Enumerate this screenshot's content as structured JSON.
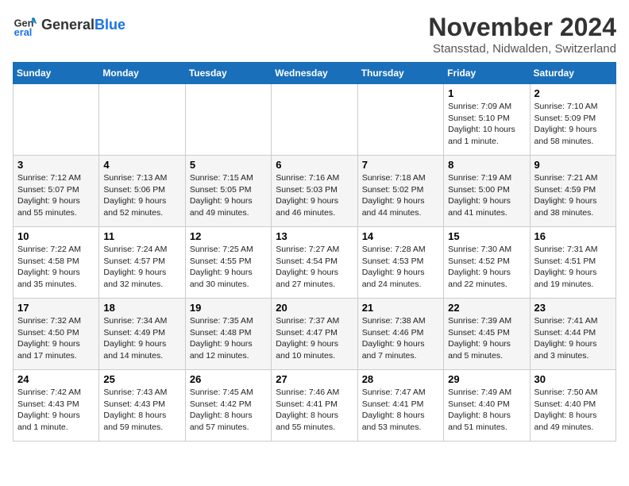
{
  "header": {
    "logo_line1": "General",
    "logo_line2": "Blue",
    "month": "November 2024",
    "location": "Stansstad, Nidwalden, Switzerland"
  },
  "days_of_week": [
    "Sunday",
    "Monday",
    "Tuesday",
    "Wednesday",
    "Thursday",
    "Friday",
    "Saturday"
  ],
  "weeks": [
    [
      {
        "day": "",
        "info": ""
      },
      {
        "day": "",
        "info": ""
      },
      {
        "day": "",
        "info": ""
      },
      {
        "day": "",
        "info": ""
      },
      {
        "day": "",
        "info": ""
      },
      {
        "day": "1",
        "info": "Sunrise: 7:09 AM\nSunset: 5:10 PM\nDaylight: 10 hours and 1 minute."
      },
      {
        "day": "2",
        "info": "Sunrise: 7:10 AM\nSunset: 5:09 PM\nDaylight: 9 hours and 58 minutes."
      }
    ],
    [
      {
        "day": "3",
        "info": "Sunrise: 7:12 AM\nSunset: 5:07 PM\nDaylight: 9 hours and 55 minutes."
      },
      {
        "day": "4",
        "info": "Sunrise: 7:13 AM\nSunset: 5:06 PM\nDaylight: 9 hours and 52 minutes."
      },
      {
        "day": "5",
        "info": "Sunrise: 7:15 AM\nSunset: 5:05 PM\nDaylight: 9 hours and 49 minutes."
      },
      {
        "day": "6",
        "info": "Sunrise: 7:16 AM\nSunset: 5:03 PM\nDaylight: 9 hours and 46 minutes."
      },
      {
        "day": "7",
        "info": "Sunrise: 7:18 AM\nSunset: 5:02 PM\nDaylight: 9 hours and 44 minutes."
      },
      {
        "day": "8",
        "info": "Sunrise: 7:19 AM\nSunset: 5:00 PM\nDaylight: 9 hours and 41 minutes."
      },
      {
        "day": "9",
        "info": "Sunrise: 7:21 AM\nSunset: 4:59 PM\nDaylight: 9 hours and 38 minutes."
      }
    ],
    [
      {
        "day": "10",
        "info": "Sunrise: 7:22 AM\nSunset: 4:58 PM\nDaylight: 9 hours and 35 minutes."
      },
      {
        "day": "11",
        "info": "Sunrise: 7:24 AM\nSunset: 4:57 PM\nDaylight: 9 hours and 32 minutes."
      },
      {
        "day": "12",
        "info": "Sunrise: 7:25 AM\nSunset: 4:55 PM\nDaylight: 9 hours and 30 minutes."
      },
      {
        "day": "13",
        "info": "Sunrise: 7:27 AM\nSunset: 4:54 PM\nDaylight: 9 hours and 27 minutes."
      },
      {
        "day": "14",
        "info": "Sunrise: 7:28 AM\nSunset: 4:53 PM\nDaylight: 9 hours and 24 minutes."
      },
      {
        "day": "15",
        "info": "Sunrise: 7:30 AM\nSunset: 4:52 PM\nDaylight: 9 hours and 22 minutes."
      },
      {
        "day": "16",
        "info": "Sunrise: 7:31 AM\nSunset: 4:51 PM\nDaylight: 9 hours and 19 minutes."
      }
    ],
    [
      {
        "day": "17",
        "info": "Sunrise: 7:32 AM\nSunset: 4:50 PM\nDaylight: 9 hours and 17 minutes."
      },
      {
        "day": "18",
        "info": "Sunrise: 7:34 AM\nSunset: 4:49 PM\nDaylight: 9 hours and 14 minutes."
      },
      {
        "day": "19",
        "info": "Sunrise: 7:35 AM\nSunset: 4:48 PM\nDaylight: 9 hours and 12 minutes."
      },
      {
        "day": "20",
        "info": "Sunrise: 7:37 AM\nSunset: 4:47 PM\nDaylight: 9 hours and 10 minutes."
      },
      {
        "day": "21",
        "info": "Sunrise: 7:38 AM\nSunset: 4:46 PM\nDaylight: 9 hours and 7 minutes."
      },
      {
        "day": "22",
        "info": "Sunrise: 7:39 AM\nSunset: 4:45 PM\nDaylight: 9 hours and 5 minutes."
      },
      {
        "day": "23",
        "info": "Sunrise: 7:41 AM\nSunset: 4:44 PM\nDaylight: 9 hours and 3 minutes."
      }
    ],
    [
      {
        "day": "24",
        "info": "Sunrise: 7:42 AM\nSunset: 4:43 PM\nDaylight: 9 hours and 1 minute."
      },
      {
        "day": "25",
        "info": "Sunrise: 7:43 AM\nSunset: 4:43 PM\nDaylight: 8 hours and 59 minutes."
      },
      {
        "day": "26",
        "info": "Sunrise: 7:45 AM\nSunset: 4:42 PM\nDaylight: 8 hours and 57 minutes."
      },
      {
        "day": "27",
        "info": "Sunrise: 7:46 AM\nSunset: 4:41 PM\nDaylight: 8 hours and 55 minutes."
      },
      {
        "day": "28",
        "info": "Sunrise: 7:47 AM\nSunset: 4:41 PM\nDaylight: 8 hours and 53 minutes."
      },
      {
        "day": "29",
        "info": "Sunrise: 7:49 AM\nSunset: 4:40 PM\nDaylight: 8 hours and 51 minutes."
      },
      {
        "day": "30",
        "info": "Sunrise: 7:50 AM\nSunset: 4:40 PM\nDaylight: 8 hours and 49 minutes."
      }
    ]
  ]
}
